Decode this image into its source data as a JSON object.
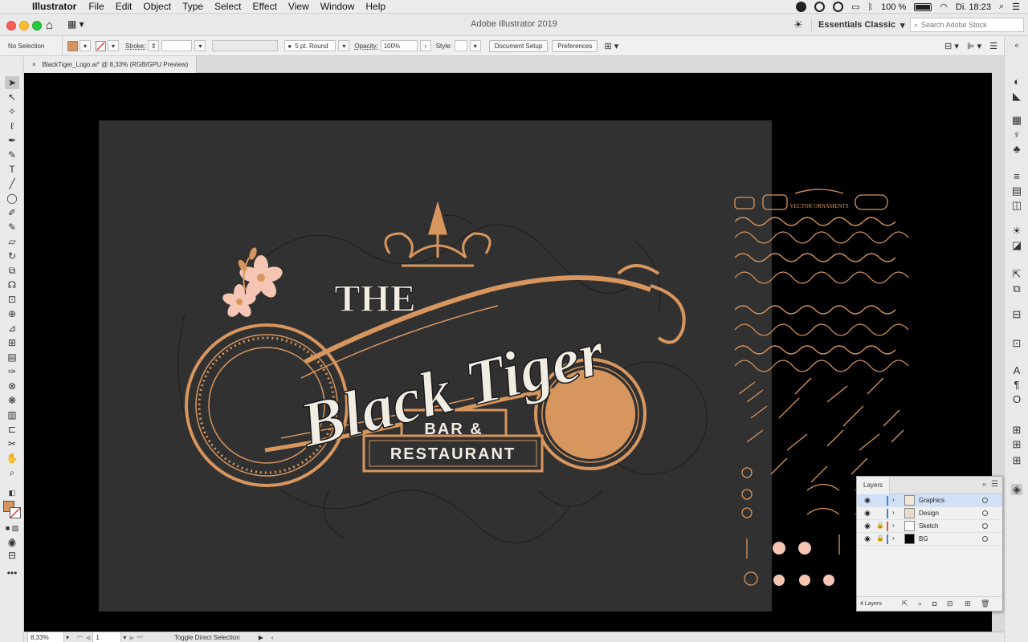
{
  "menubar": {
    "app_name": "Illustrator",
    "items": [
      "File",
      "Edit",
      "Object",
      "Type",
      "Select",
      "Effect",
      "View",
      "Window",
      "Help"
    ],
    "battery": "100 %",
    "clock": "Di. 18:23"
  },
  "titlebar": {
    "title": "Adobe Illustrator 2019",
    "workspace": "Essentials Classic",
    "search_placeholder": "Search Adobe Stock"
  },
  "controlbar": {
    "selection": "No Selection",
    "stroke_label": "Stroke:",
    "brush": "5 pt. Round",
    "opacity_label": "Opacity:",
    "opacity_value": "100%",
    "style_label": "Style:",
    "document_setup": "Document Setup",
    "preferences": "Preferences",
    "fill_color": "#d8965f"
  },
  "document": {
    "tab_title": "BlackTiger_Logo.ai* @ 8,33% (RGB/GPU Preview)"
  },
  "artwork": {
    "line1": "THE",
    "line2": "Black Tiger",
    "line3": "BAR &",
    "line4": "RESTAURANT",
    "accent_color": "#d8965f",
    "cream_color": "#f1ece4",
    "ornaments_title": "VECTOR ORNAMENTS"
  },
  "statusbar": {
    "zoom": "8,33%",
    "artboard": "1",
    "message": "Toggle Direct Selection"
  },
  "layers_panel": {
    "title": "Layers",
    "rows": [
      {
        "name": "Graphics",
        "locked": false,
        "color": "#4a7de8"
      },
      {
        "name": "Design",
        "locked": false,
        "color": "#4a7de8"
      },
      {
        "name": "Sketch",
        "locked": true,
        "color": "#e84a4a"
      },
      {
        "name": "BG",
        "locked": true,
        "color": "#4a7de8"
      }
    ],
    "count": "4 Layers"
  }
}
